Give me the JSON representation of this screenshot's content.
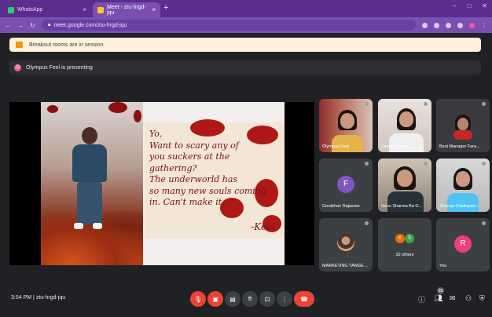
{
  "browser": {
    "tabs": [
      {
        "label": "WhatsApp"
      },
      {
        "label": "Meet - ztu-hrgd-jqu"
      }
    ],
    "new_tab": "+",
    "window_controls": [
      "–",
      "□",
      "✕"
    ],
    "address": "meet.google.com/ztu-hrgd-jqu"
  },
  "meeting": {
    "banner_text": "Breakout rooms are in session",
    "presenting_initial": "O",
    "presenting_text": "Olympus Feel is presenting",
    "slide": {
      "quote_lines": [
        "Yo,",
        "Want to scary any of",
        "you suckers at the",
        "gathering?",
        "The underworld has",
        "so many new souls coming",
        "in. Can't make it."
      ],
      "signature": "-Keel"
    },
    "participants": [
      {
        "name": "Olympus Feel",
        "type": "camera"
      },
      {
        "name": "Seema Bansal",
        "type": "camera"
      },
      {
        "name": "Best Manager Fara...",
        "type": "camera"
      },
      {
        "name": "Gorakhan Rajasree",
        "type": "initial",
        "initial": "F",
        "color": "#7e57c2"
      },
      {
        "name": "Sonu Sharma Ba G...",
        "type": "camera"
      },
      {
        "name": "Shreeja Chattopad...",
        "type": "camera"
      },
      {
        "name": "MARKETING TANGER...",
        "type": "avatar"
      },
      {
        "name": "32 others",
        "type": "others",
        "initials": [
          "K",
          "S"
        ],
        "colors": [
          "#ef6c00",
          "#43a047"
        ]
      },
      {
        "name": "You",
        "type": "initial",
        "initial": "R",
        "color": "#ec407a"
      }
    ],
    "clock": "3:54 PM",
    "separator": "|",
    "meeting_code": "ztu-hrgd-jqu",
    "people_count": "35"
  }
}
